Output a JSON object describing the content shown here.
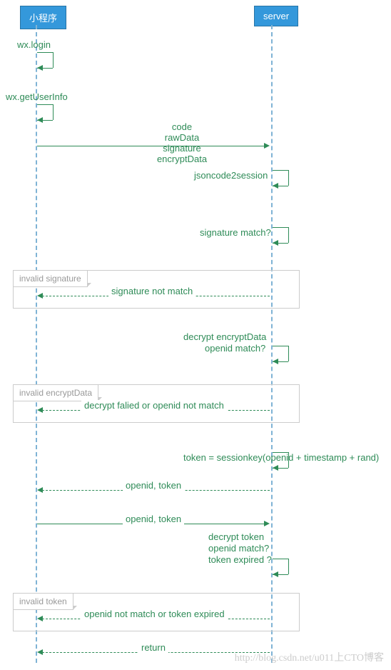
{
  "participants": {
    "client": "小程序",
    "server": "server"
  },
  "messages": {
    "login": "wx.login",
    "getUserInfo": "wx.getUserInfo",
    "sendData": {
      "l1": "code",
      "l2": "rawData",
      "l3": "signature",
      "l4": "encryptData"
    },
    "jsoncode2session": "jsoncode2session",
    "sigMatch": "signature match?",
    "sigNotMatch": "signature not match",
    "decryptEncrypt": {
      "l1": "decrypt encryptData",
      "l2": "openid match?"
    },
    "decryptFailed": "decrypt falied or openid not match",
    "tokenGen": "token = sessionkey(openid + timestamp + rand)",
    "openidToken": "openid, token",
    "openidToken2": "openid, token",
    "decryptToken": {
      "l1": "decrypt token",
      "l2": "openid match?",
      "l3": "token expired ?"
    },
    "tokenFailed": "openid not match or token expired",
    "return": "return"
  },
  "alts": {
    "invalidSig": "invalid signature",
    "invalidEnc": "invalid encryptData",
    "invalidTok": "invalid token"
  },
  "watermark": "http://blog.csdn.net/u011上CTO博客"
}
